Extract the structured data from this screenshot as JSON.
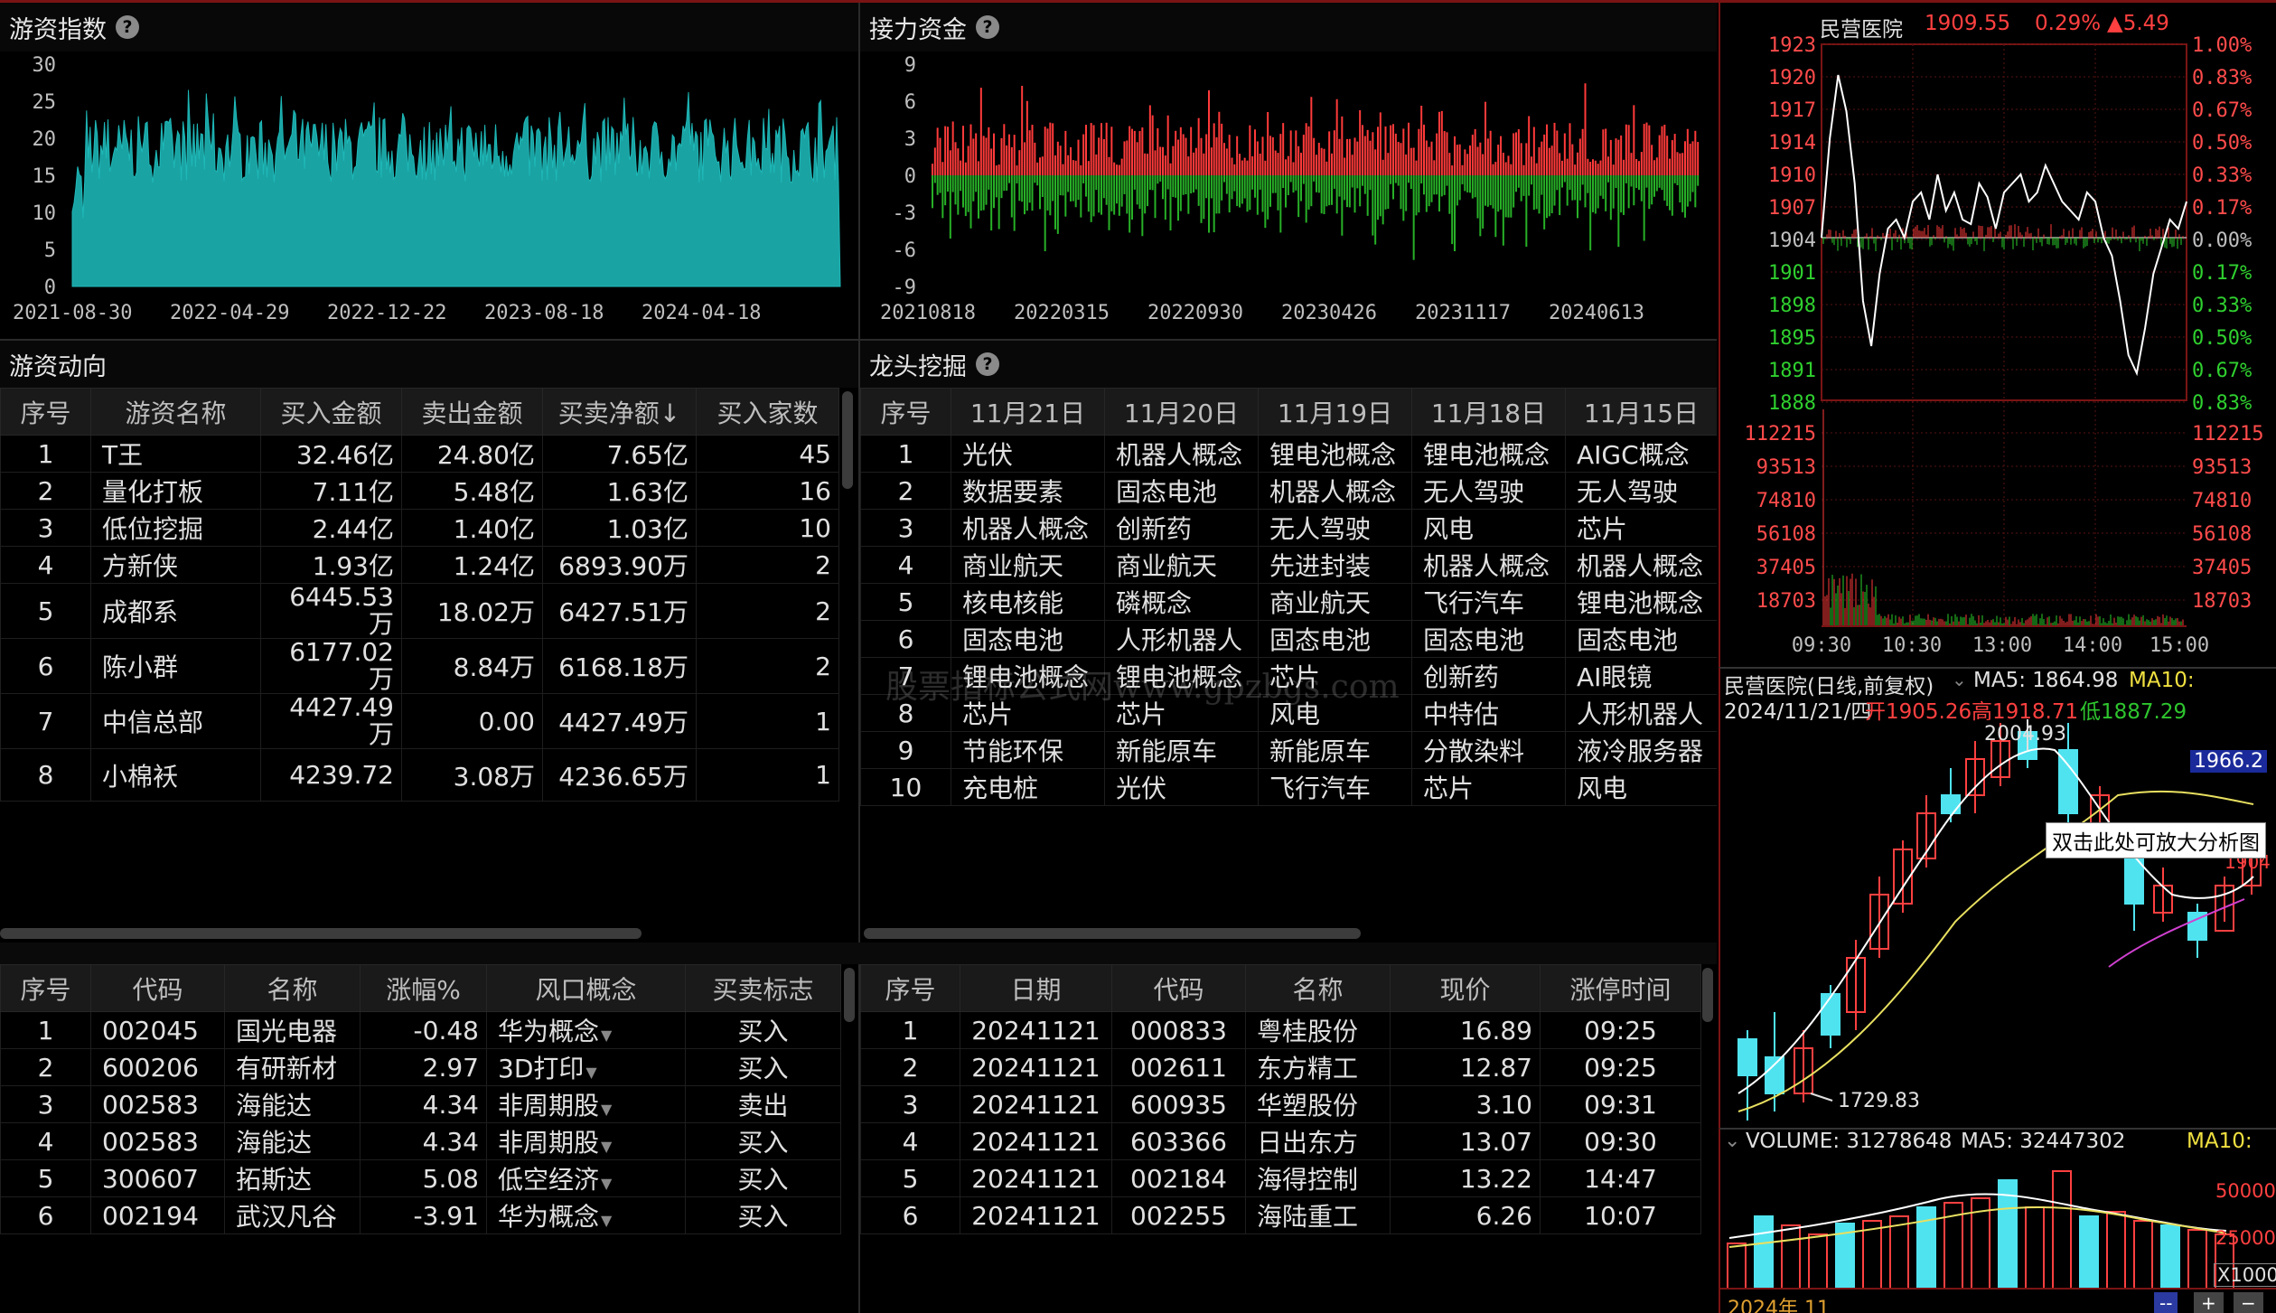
{
  "colors": {
    "up": "#ff4040",
    "down": "#2ec52e",
    "teal": "#1aa3a3",
    "cyan": "#4fe3f0"
  },
  "index_panel": {
    "title": "游资指数",
    "y_ticks": [
      "30",
      "25",
      "20",
      "15",
      "10",
      "5",
      "0"
    ],
    "x_ticks": [
      "2021-08-30",
      "2022-04-29",
      "2022-12-22",
      "2023-08-18",
      "2024-04-18"
    ]
  },
  "relay_panel": {
    "title": "接力资金",
    "y_ticks": [
      "9",
      "6",
      "3",
      "0",
      "-3",
      "-6",
      "-9"
    ],
    "x_ticks": [
      "20210818",
      "20220315",
      "20220930",
      "20230426",
      "20231117",
      "20240613"
    ]
  },
  "flow_panel": {
    "title": "游资动向",
    "headers": [
      "序号",
      "游资名称",
      "买入金额",
      "卖出金额",
      "买卖净额↓",
      "买入家数"
    ],
    "rows": [
      {
        "no": "1",
        "name": "T王",
        "buy": "32.46亿",
        "sell": "24.80亿",
        "net": "7.65亿",
        "count": "45"
      },
      {
        "no": "2",
        "name": "量化打板",
        "buy": "7.11亿",
        "sell": "5.48亿",
        "net": "1.63亿",
        "count": "16"
      },
      {
        "no": "3",
        "name": "低位挖掘",
        "buy": "2.44亿",
        "sell": "1.40亿",
        "net": "1.03亿",
        "count": "10"
      },
      {
        "no": "4",
        "name": "方新侠",
        "buy": "1.93亿",
        "sell": "1.24亿",
        "net": "6893.90万",
        "count": "2"
      },
      {
        "no": "5",
        "name": "成都系",
        "buy1": "6445.53",
        "buy2": "万",
        "sell": "18.02万",
        "net": "6427.51万",
        "count": "2"
      },
      {
        "no": "6",
        "name": "陈小群",
        "buy1": "6177.02",
        "buy2": "万",
        "sell": "8.84万",
        "net": "6168.18万",
        "count": "2"
      },
      {
        "no": "7",
        "name": "中信总部",
        "buy1": "4427.49",
        "buy2": "万",
        "sell": "0.00",
        "net": "4427.49万",
        "count": "1"
      },
      {
        "no": "8",
        "name": "小棉袄",
        "buy1": "4239.72",
        "buy2": "",
        "sell": "3.08万",
        "net": "4236.65万",
        "count": "1"
      }
    ]
  },
  "dragon_panel": {
    "title": "龙头挖掘",
    "headers": [
      "序号",
      "11月21日",
      "11月20日",
      "11月19日",
      "11月18日",
      "11月15日"
    ],
    "rows": [
      [
        "1",
        "光伏",
        "机器人概念",
        "锂电池概念",
        "锂电池概念",
        "AIGC概念"
      ],
      [
        "2",
        "数据要素",
        "固态电池",
        "机器人概念",
        "无人驾驶",
        "无人驾驶"
      ],
      [
        "3",
        "机器人概念",
        "创新药",
        "无人驾驶",
        "风电",
        "芯片"
      ],
      [
        "4",
        "商业航天",
        "商业航天",
        "先进封装",
        "机器人概念",
        "机器人概念"
      ],
      [
        "5",
        "核电核能",
        "磷概念",
        "商业航天",
        "飞行汽车",
        "锂电池概念"
      ],
      [
        "6",
        "固态电池",
        "人形机器人",
        "固态电池",
        "固态电池",
        "固态电池"
      ],
      [
        "7",
        "锂电池概念",
        "锂电池概念",
        "芯片",
        "创新药",
        "AI眼镜"
      ],
      [
        "8",
        "芯片",
        "芯片",
        "风电",
        "中特估",
        "人形机器人"
      ],
      [
        "9",
        "节能环保",
        "新能原车",
        "新能原车",
        "分散染料",
        "液冷服务器"
      ],
      [
        "10",
        "充电桩",
        "光伏",
        "飞行汽车",
        "芯片",
        "风电"
      ]
    ]
  },
  "signal_panel": {
    "headers": [
      "序号",
      "代码",
      "名称",
      "涨幅%",
      "风口概念",
      "买卖标志"
    ],
    "rows": [
      {
        "no": "1",
        "code": "002045",
        "name": "国光电器",
        "chg": "-0.48",
        "concept": "华为概念",
        "flag": "买入",
        "up": false,
        "buy": true
      },
      {
        "no": "2",
        "code": "600206",
        "name": "有研新材",
        "chg": "2.97",
        "concept": "3D打印",
        "flag": "买入",
        "up": true,
        "buy": true
      },
      {
        "no": "3",
        "code": "002583",
        "name": "海能达",
        "chg": "4.34",
        "concept": "非周期股",
        "flag": "卖出",
        "up": true,
        "buy": false
      },
      {
        "no": "4",
        "code": "002583",
        "name": "海能达",
        "chg": "4.34",
        "concept": "非周期股",
        "flag": "买入",
        "up": true,
        "buy": true
      },
      {
        "no": "5",
        "code": "300607",
        "name": "拓斯达",
        "chg": "5.08",
        "concept": "低空经济",
        "flag": "买入",
        "up": true,
        "buy": true
      },
      {
        "no": "6",
        "code": "002194",
        "name": "武汉凡谷",
        "chg": "-3.91",
        "concept": "华为概念",
        "flag": "买入",
        "up": false,
        "buy": true
      }
    ]
  },
  "limit_panel": {
    "headers": [
      "序号",
      "日期",
      "代码",
      "名称",
      "现价",
      "涨停时间"
    ],
    "rows": [
      [
        "1",
        "20241121",
        "000833",
        "粤桂股份",
        "16.89",
        "09:25"
      ],
      [
        "2",
        "20241121",
        "002611",
        "东方精工",
        "12.87",
        "09:25"
      ],
      [
        "3",
        "20241121",
        "600935",
        "华塑股份",
        "3.10",
        "09:31"
      ],
      [
        "4",
        "20241121",
        "603366",
        "日出东方",
        "13.07",
        "09:30"
      ],
      [
        "5",
        "20241121",
        "002184",
        "海得控制",
        "13.22",
        "14:47"
      ],
      [
        "6",
        "20241121",
        "002255",
        "海陆重工",
        "6.26",
        "10:07"
      ]
    ]
  },
  "intraday": {
    "name": "民营医院",
    "price": "1909.55",
    "pct": "0.29%",
    "chg": "▲5.49",
    "left_prices": [
      "1923",
      "1920",
      "1917",
      "1914",
      "1910",
      "1907",
      "1904",
      "1901",
      "1898",
      "1895",
      "1891",
      "1888"
    ],
    "right_pcts": [
      "1.00%",
      "0.83%",
      "0.67%",
      "0.50%",
      "0.33%",
      "0.17%",
      "0.00%",
      "0.17%",
      "0.33%",
      "0.50%",
      "0.67%",
      "0.83%"
    ],
    "vol_ticks": [
      "112215",
      "93513",
      "74810",
      "56108",
      "37405",
      "18703"
    ],
    "times": [
      "09:30",
      "10:30",
      "13:00",
      "14:00",
      "15:00"
    ]
  },
  "kline": {
    "title": "民营医院(日线,前复权)",
    "ma5_label": "MA5: 1864.98",
    "ma10_label": "MA10:",
    "date": "2024/11/21/四",
    "open": "开1905.26",
    "high": "高1918.71",
    "low": "低1887.29",
    "peak": "2004.93",
    "trough": "1729.83",
    "cursor_price": "1966.2",
    "partial_price": "1904",
    "tooltip": "双击此处可放大分析图"
  },
  "volume": {
    "label": "VOLUME: 31278648",
    "ma5": "MA5: 32447302",
    "ma10": "MA10:",
    "ticks": [
      "50000",
      "25000"
    ],
    "unit": "X1000",
    "period": "2024年 11",
    "btn_minus": "--",
    "btn_plus": "+",
    "btn_minus2": "−"
  },
  "watermark": "股票指标公式网www.gpzbgs.com"
}
